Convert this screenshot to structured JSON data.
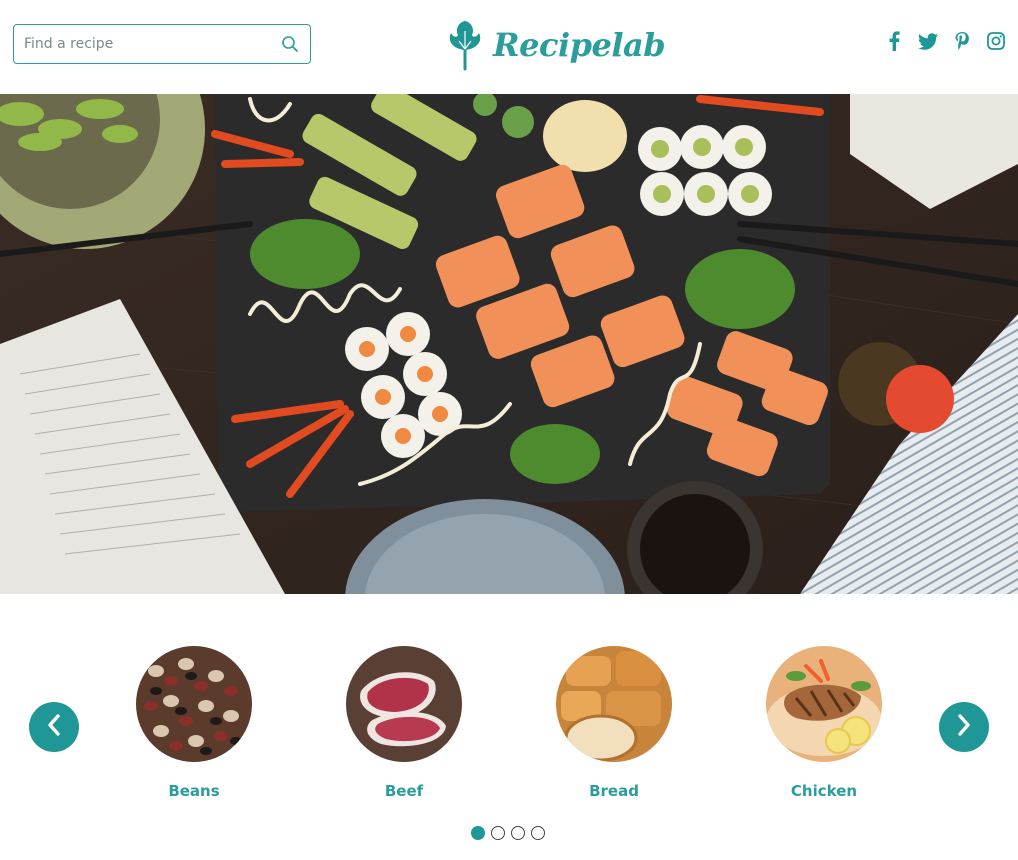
{
  "header": {
    "search": {
      "placeholder": "Find a recipe",
      "value": ""
    },
    "logo_text": "Recipelab",
    "social": [
      "facebook-icon",
      "twitter-icon",
      "pinterest-icon",
      "instagram-icon"
    ]
  },
  "hero": {
    "alt": "sushi platter on a slate board"
  },
  "carousel": {
    "prev_label": "‹",
    "next_label": "›",
    "categories": [
      {
        "label": "Beans"
      },
      {
        "label": "Beef"
      },
      {
        "label": "Bread"
      },
      {
        "label": "Chicken"
      }
    ],
    "dots": {
      "count": 4,
      "active": 0
    }
  },
  "colors": {
    "accent": "#2a9d9c",
    "button": "#1f9796"
  }
}
